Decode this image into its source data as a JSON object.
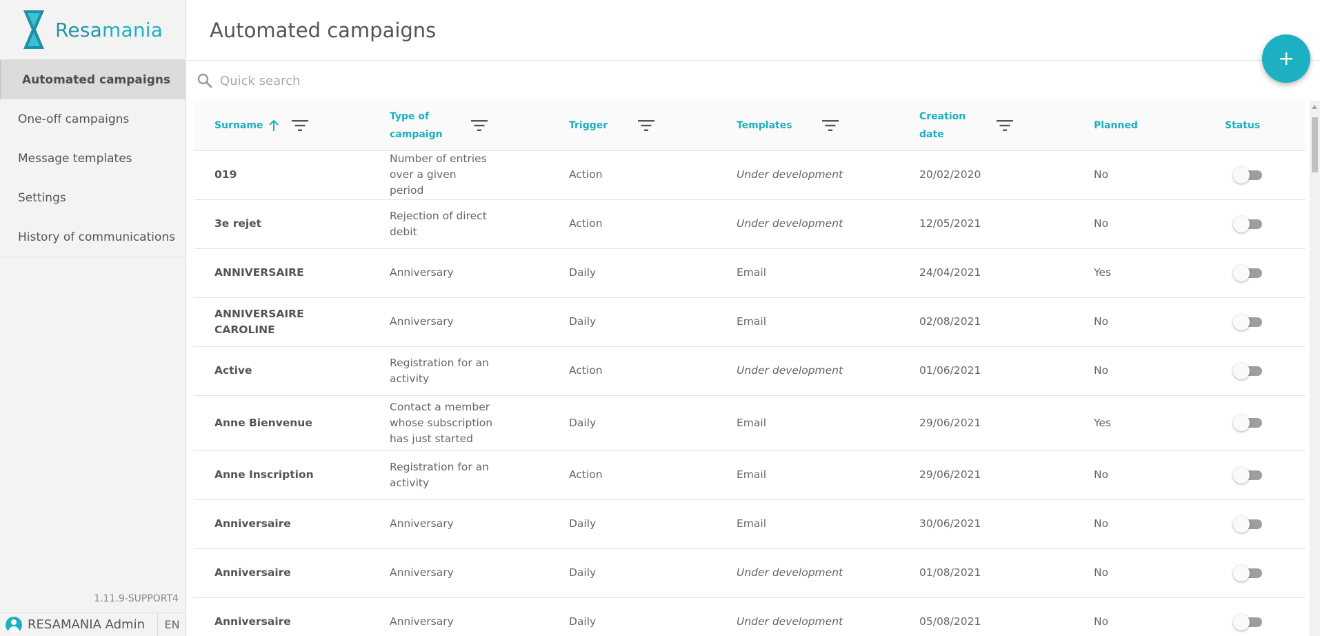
{
  "brand": {
    "name_part1": "Resa",
    "name_part2": "mania"
  },
  "sidebar": {
    "items": [
      {
        "label": "Automated campaigns",
        "active": true
      },
      {
        "label": "One-off campaigns",
        "active": false
      },
      {
        "label": "Message templates",
        "active": false
      },
      {
        "label": "Settings",
        "active": false
      },
      {
        "label": "History of communications",
        "active": false
      }
    ],
    "version": "1.11.9-SUPPORT4",
    "user_name": "RESAMANIA Admin",
    "language": "EN"
  },
  "header": {
    "title": "Automated campaigns",
    "add_button_icon": "plus-icon"
  },
  "search": {
    "placeholder": "Quick search",
    "value": ""
  },
  "table": {
    "columns": [
      {
        "label": "Surname",
        "sortable": true,
        "sort": "asc",
        "filterable": true
      },
      {
        "label": "Type of campaign",
        "sortable": false,
        "filterable": true
      },
      {
        "label": "Trigger",
        "sortable": false,
        "filterable": true
      },
      {
        "label": "Templates",
        "sortable": false,
        "filterable": true
      },
      {
        "label": "Creation date",
        "sortable": false,
        "filterable": true
      },
      {
        "label": "Planned",
        "sortable": false,
        "filterable": false
      },
      {
        "label": "Status",
        "sortable": false,
        "filterable": false
      }
    ],
    "rows": [
      {
        "surname": "019",
        "type": "Number of entries over a given period",
        "trigger": "Action",
        "templates": "Under development",
        "templates_italic": true,
        "date": "20/02/2020",
        "planned": "No",
        "status": false
      },
      {
        "surname": "3e rejet",
        "type": "Rejection of direct debit",
        "trigger": "Action",
        "templates": "Under development",
        "templates_italic": true,
        "date": "12/05/2021",
        "planned": "No",
        "status": false
      },
      {
        "surname": "ANNIVERSAIRE",
        "type": "Anniversary",
        "trigger": "Daily",
        "templates": "Email",
        "templates_italic": false,
        "date": "24/04/2021",
        "planned": "Yes",
        "status": false
      },
      {
        "surname": "ANNIVERSAIRE CAROLINE",
        "type": "Anniversary",
        "trigger": "Daily",
        "templates": "Email",
        "templates_italic": false,
        "date": "02/08/2021",
        "planned": "No",
        "status": false
      },
      {
        "surname": "Active",
        "type": "Registration for an activity",
        "trigger": "Action",
        "templates": "Under development",
        "templates_italic": true,
        "date": "01/06/2021",
        "planned": "No",
        "status": false
      },
      {
        "surname": "Anne Bienvenue",
        "type": "Contact a member whose subscription has just started",
        "trigger": "Daily",
        "templates": "Email",
        "templates_italic": false,
        "date": "29/06/2021",
        "planned": "Yes",
        "status": false
      },
      {
        "surname": "Anne Inscription",
        "type": "Registration for an activity",
        "trigger": "Action",
        "templates": "Email",
        "templates_italic": false,
        "date": "29/06/2021",
        "planned": "No",
        "status": false
      },
      {
        "surname": "Anniversaire",
        "type": "Anniversary",
        "trigger": "Daily",
        "templates": "Email",
        "templates_italic": false,
        "date": "30/06/2021",
        "planned": "No",
        "status": false
      },
      {
        "surname": "Anniversaire",
        "type": "Anniversary",
        "trigger": "Daily",
        "templates": "Under development",
        "templates_italic": true,
        "date": "01/08/2021",
        "planned": "No",
        "status": false
      },
      {
        "surname": "Anniversaire",
        "type": "Anniversary",
        "trigger": "Daily",
        "templates": "Under development",
        "templates_italic": true,
        "date": "05/08/2021",
        "planned": "No",
        "status": false
      }
    ]
  },
  "colors": {
    "accent": "#1db0c2",
    "brand_dark": "#2196a8",
    "toggle_off": "#9e9e9e"
  }
}
